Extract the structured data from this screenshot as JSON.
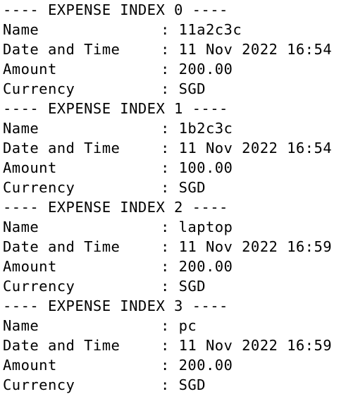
{
  "entries": [
    {
      "header": "---- EXPENSE INDEX 0 ----",
      "fields": [
        {
          "key": "Name",
          "value": ": 11a2c3c"
        },
        {
          "key": "Date and Time",
          "value": ": 11 Nov 2022 16:54"
        },
        {
          "key": "Amount",
          "value": ": 200.00"
        },
        {
          "key": "Currency",
          "value": ": SGD"
        }
      ]
    },
    {
      "header": "---- EXPENSE INDEX 1 ----",
      "fields": [
        {
          "key": "Name",
          "value": ": 1b2c3c"
        },
        {
          "key": "Date and Time",
          "value": ": 11 Nov 2022 16:54"
        },
        {
          "key": "Amount",
          "value": ": 100.00"
        },
        {
          "key": "Currency",
          "value": ": SGD"
        }
      ]
    },
    {
      "header": "---- EXPENSE INDEX 2 ----",
      "fields": [
        {
          "key": "Name",
          "value": ": laptop"
        },
        {
          "key": "Date and Time",
          "value": ": 11 Nov 2022 16:59"
        },
        {
          "key": "Amount",
          "value": ": 200.00"
        },
        {
          "key": "Currency",
          "value": ": SGD"
        }
      ]
    },
    {
      "header": "---- EXPENSE INDEX 3 ----",
      "fields": [
        {
          "key": "Name",
          "value": ": pc"
        },
        {
          "key": "Date and Time",
          "value": ": 11 Nov 2022 16:59"
        },
        {
          "key": "Amount",
          "value": ": 200.00"
        },
        {
          "key": "Currency",
          "value": ": SGD"
        }
      ]
    }
  ]
}
